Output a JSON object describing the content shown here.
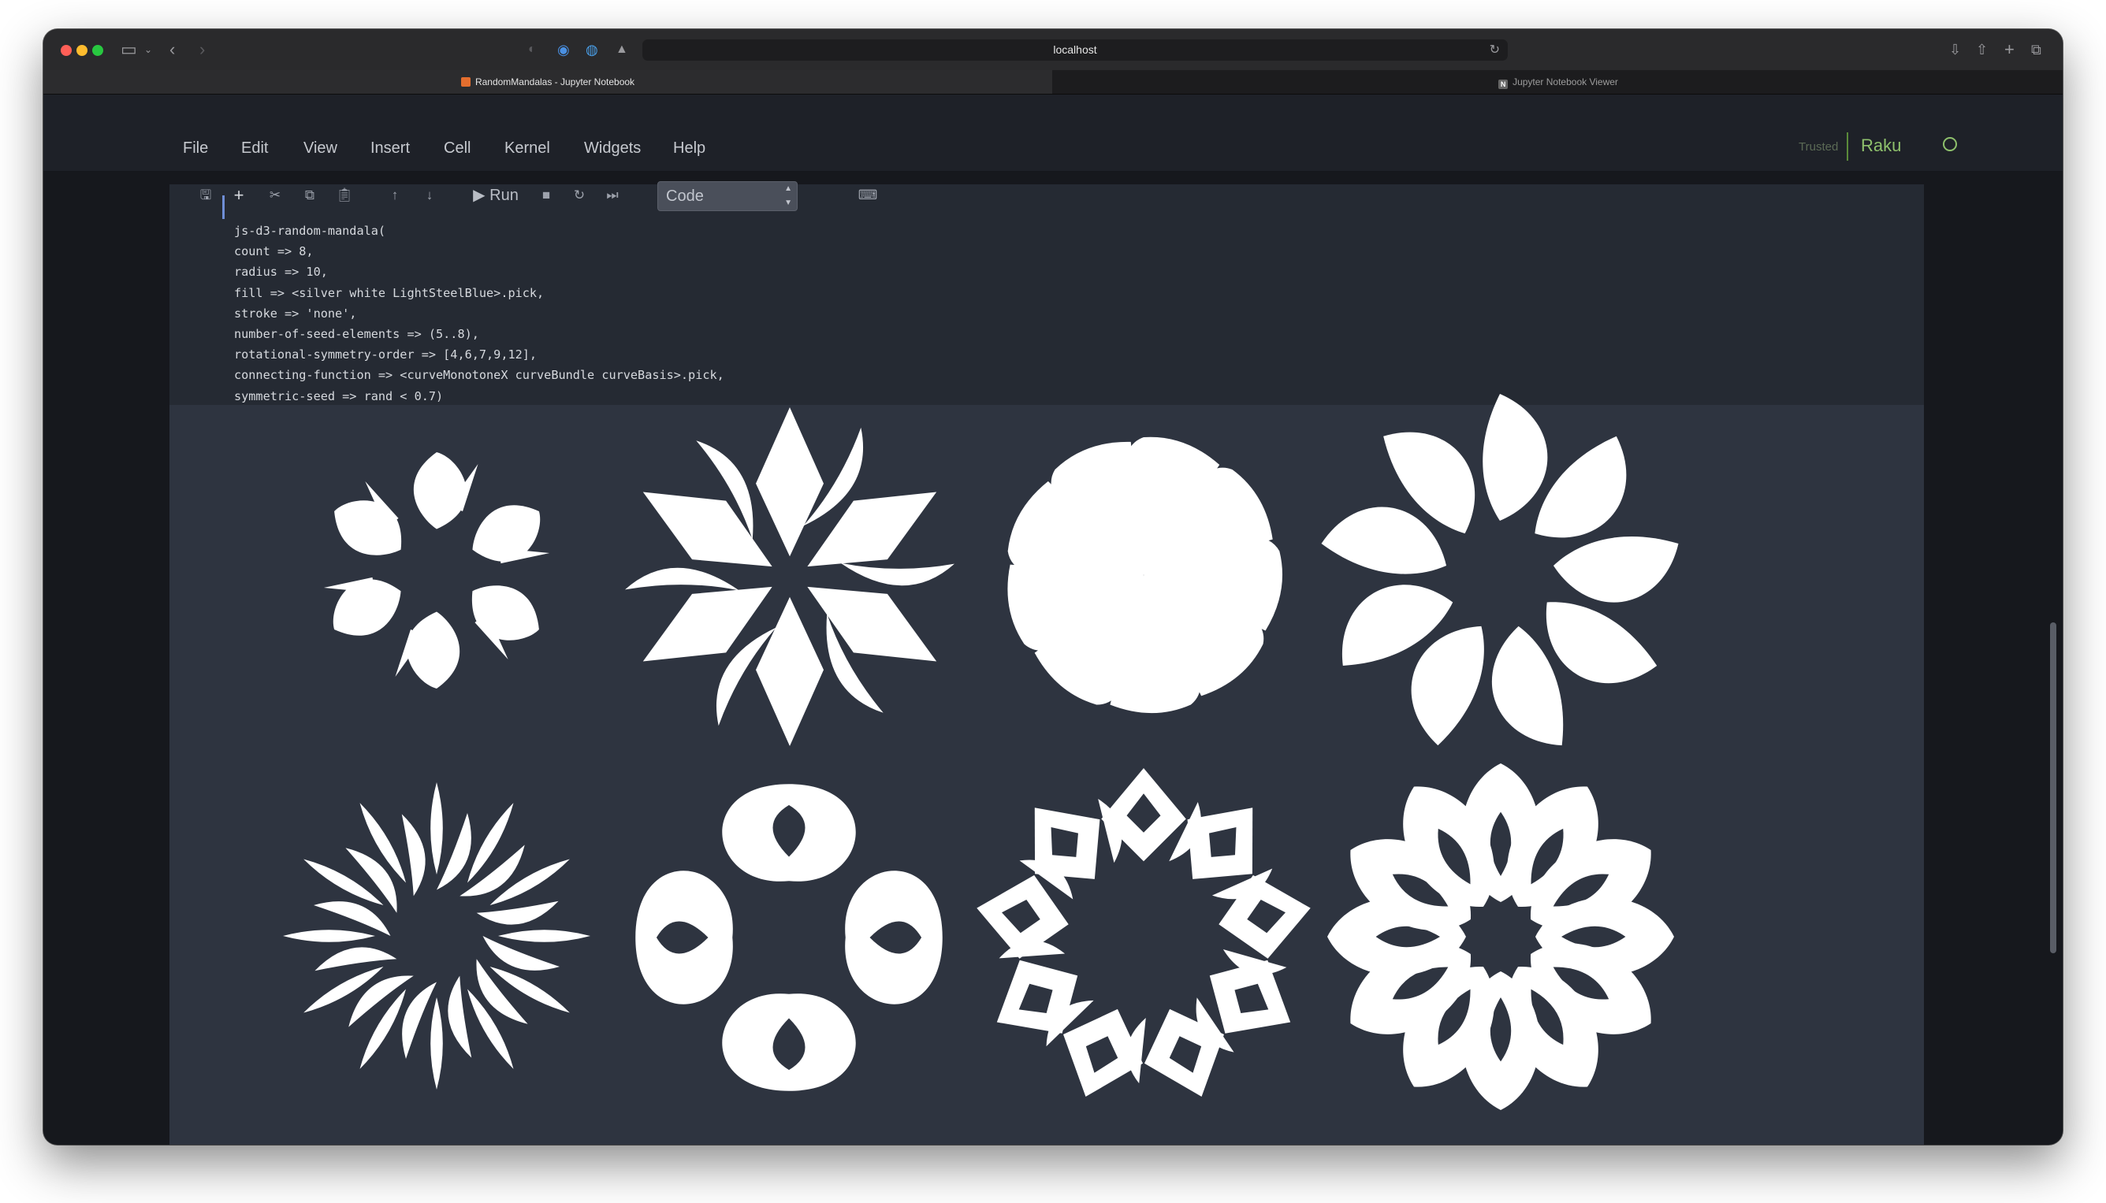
{
  "browser": {
    "url": "localhost",
    "tabs": [
      {
        "label": "RandomMandalas - Jupyter Notebook",
        "active": true,
        "favicon": "jupyter-favicon-icon"
      },
      {
        "label": "Jupyter Notebook Viewer",
        "active": false,
        "favicon": "nbviewer-favicon-icon"
      }
    ]
  },
  "menu": [
    "File",
    "Edit",
    "View",
    "Insert",
    "Cell",
    "Kernel",
    "Widgets",
    "Help"
  ],
  "status": {
    "trusted": "Trusted",
    "kernel": "Raku",
    "kernel_color": "#8ec06c"
  },
  "toolbar": {
    "run_label": "Run",
    "cell_type": "Code",
    "icons": [
      "save-icon",
      "plus-icon",
      "cut-icon",
      "copy-icon",
      "paste-icon",
      "arrow-up-icon",
      "arrow-down-icon",
      "run-icon",
      "stop-icon",
      "restart-icon",
      "fast-forward-icon",
      "keyboard-icon"
    ]
  },
  "cell": {
    "code_lines": [
      "js-d3-random-mandala(",
      "count => 8,",
      "radius => 10,",
      "fill => <silver white LightSteelBlue>.pick,",
      "stroke => 'none',",
      "number-of-seed-elements => (5..8),",
      "rotational-symmetry-order => [4,6,7,9,12],",
      "connecting-function => <curveMonotoneX curveBundle curveBasis>.pick,",
      "symmetric-seed => rand < 0.7)"
    ]
  },
  "output": {
    "background": "#2e3440",
    "mandala_fill": "#ffffff",
    "mandalas": [
      {
        "symmetry": 6
      },
      {
        "symmetry": 6
      },
      {
        "symmetry": 9
      },
      {
        "symmetry": 9
      },
      {
        "symmetry": 12
      },
      {
        "symmetry": 4
      },
      {
        "symmetry": 9
      },
      {
        "symmetry": 12
      }
    ]
  }
}
